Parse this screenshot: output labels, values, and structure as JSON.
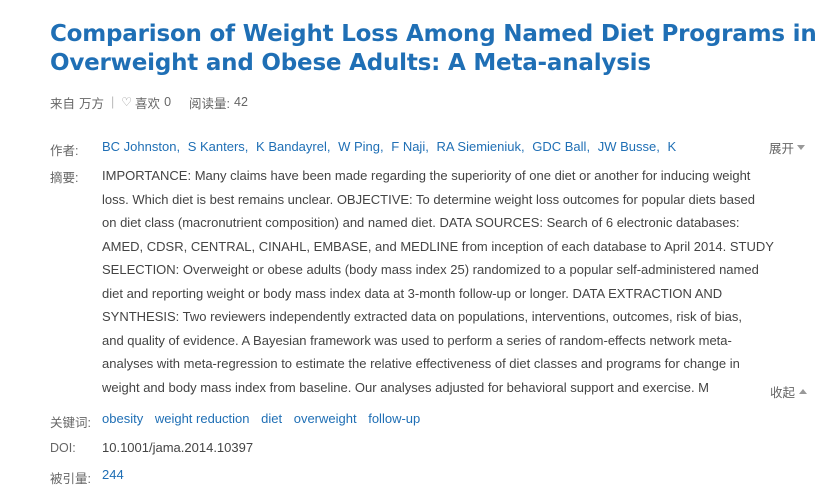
{
  "article": {
    "title_line1": "Comparison of Weight Loss Among Named Diet Programs in",
    "title_line2": "Overweight and Obese Adults: A Meta-analysis"
  },
  "meta": {
    "source_label": "来自",
    "source_value": "万方",
    "like_label": "喜欢",
    "like_count": "0",
    "reads_label": "阅读量:",
    "reads_count": "42"
  },
  "authors_label": "作者:",
  "authors": [
    "BC Johnston",
    "S Kanters",
    "K Bandayrel",
    "W Ping",
    "F Naji",
    "RA Siemieniuk",
    "GDC Ball",
    "JW Busse",
    "K"
  ],
  "expand_label": "展开",
  "abstract_label": "摘要:",
  "abstract_lines": [
    "IMPORTANCE: Many claims have been made regarding the superiority of one diet or another for inducing weight",
    "loss. Which diet is best remains unclear. OBJECTIVE: To determine weight loss outcomes for popular diets based",
    "on diet class (macronutrient composition) and named diet. DATA SOURCES: Search of 6 electronic databases:",
    "AMED, CDSR, CENTRAL, CINAHL, EMBASE, and MEDLINE from inception of each database to April 2014. STUDY",
    "SELECTION: Overweight or obese adults (body mass index 25) randomized to a popular self-administered named",
    "diet and reporting weight or body mass index data at 3-month follow-up or longer. DATA EXTRACTION AND",
    "SYNTHESIS: Two reviewers independently extracted data on populations, interventions, outcomes, risk of bias,",
    "and quality of evidence. A Bayesian framework was used to perform a series of random-effects network meta-",
    "analyses with meta-regression to estimate the relative effectiveness of diet classes and programs for change in",
    "weight and body mass index from baseline. Our analyses adjusted for behavioral support and exercise. M"
  ],
  "collapse_label": "收起",
  "keywords_label": "关键词:",
  "keywords": [
    "obesity",
    "weight reduction",
    "diet",
    "overweight",
    "follow-up"
  ],
  "doi_label": "DOI:",
  "doi": "10.1001/jama.2014.10397",
  "cited_label": "被引量:",
  "cited_count": "244"
}
